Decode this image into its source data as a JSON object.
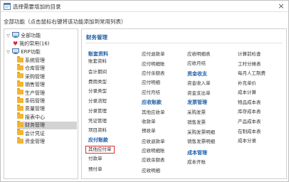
{
  "window": {
    "title": "选择需要增加的目录",
    "close_glyph": "×",
    "app_icon": "window-icon"
  },
  "hint": "全部功能（点击鼠标右键将该功能添加到常用列表）",
  "tree": {
    "root": {
      "toggle": "▽",
      "label": "全部功能"
    },
    "favorites": {
      "label": "我的常用(16)"
    },
    "erp": {
      "toggle": "▽",
      "label": "ERP功能"
    },
    "items": [
      {
        "label": "系统管理"
      },
      {
        "label": "仓库管理"
      },
      {
        "label": "采购管理"
      },
      {
        "label": "销售管理"
      },
      {
        "label": "生产管理"
      },
      {
        "label": "条码管理"
      },
      {
        "label": "质量管理"
      },
      {
        "label": "报表中心"
      },
      {
        "label": "财务管理"
      },
      {
        "label": "会计凭证"
      },
      {
        "label": "资金管理"
      }
    ],
    "selected_label": "财务管理"
  },
  "panel": {
    "title": "财务管理",
    "columns": [
      [
        {
          "label": "账套资料",
          "type": "header"
        },
        {
          "label": "账套资料"
        },
        {
          "label": "会计期间"
        },
        {
          "label": "费用类型"
        },
        {
          "label": "分录类型"
        },
        {
          "label": "分录流程"
        },
        {
          "label": "分录管理"
        },
        {
          "label": "凭证管理"
        },
        {
          "label": "项目资料"
        },
        {
          "label": "应付账款",
          "type": "header"
        },
        {
          "label": "其他应付单",
          "type": "highlight"
        },
        {
          "label": "付款单"
        },
        {
          "label": "预付单"
        }
      ],
      [
        {
          "label": "应付退款单"
        },
        {
          "label": "应付明细账"
        },
        {
          "label": "应付余额表"
        },
        {
          "label": "应付明细"
        },
        {
          "label": "应付月结"
        },
        {
          "label": "应收账款",
          "type": "header"
        },
        {
          "label": "其他应收单"
        },
        {
          "label": "收款单"
        },
        {
          "label": "预收单"
        },
        {
          "label": "应收退款单"
        },
        {
          "label": "应收明细账"
        },
        {
          "label": "应收余额表"
        },
        {
          "label": "应收明细"
        }
      ],
      [
        {
          "label": "应收明细表"
        },
        {
          "label": "应收月结"
        },
        {
          "label": "资金收支",
          "type": "header"
        },
        {
          "label": "资金收入单"
        },
        {
          "label": "资金支出单"
        },
        {
          "label": "发票管理",
          "type": "header"
        },
        {
          "label": "采购发票"
        },
        {
          "label": "销售发票"
        },
        {
          "label": "采购发票明细"
        },
        {
          "label": "销售发票明细"
        },
        {
          "label": "成本管理",
          "type": "header"
        },
        {
          "label": "成本开账"
        }
      ],
      [
        {
          "label": "计算前检查"
        },
        {
          "label": "工时分摊表"
        },
        {
          "label": "每月人工制费"
        },
        {
          "label": "补充单价"
        },
        {
          "label": "成本计算"
        },
        {
          "label": "物品成本表"
        },
        {
          "label": "库存成本表"
        },
        {
          "label": "产品成本表"
        },
        {
          "label": "在制成本表"
        },
        {
          "label": "成本分录"
        }
      ]
    ]
  }
}
